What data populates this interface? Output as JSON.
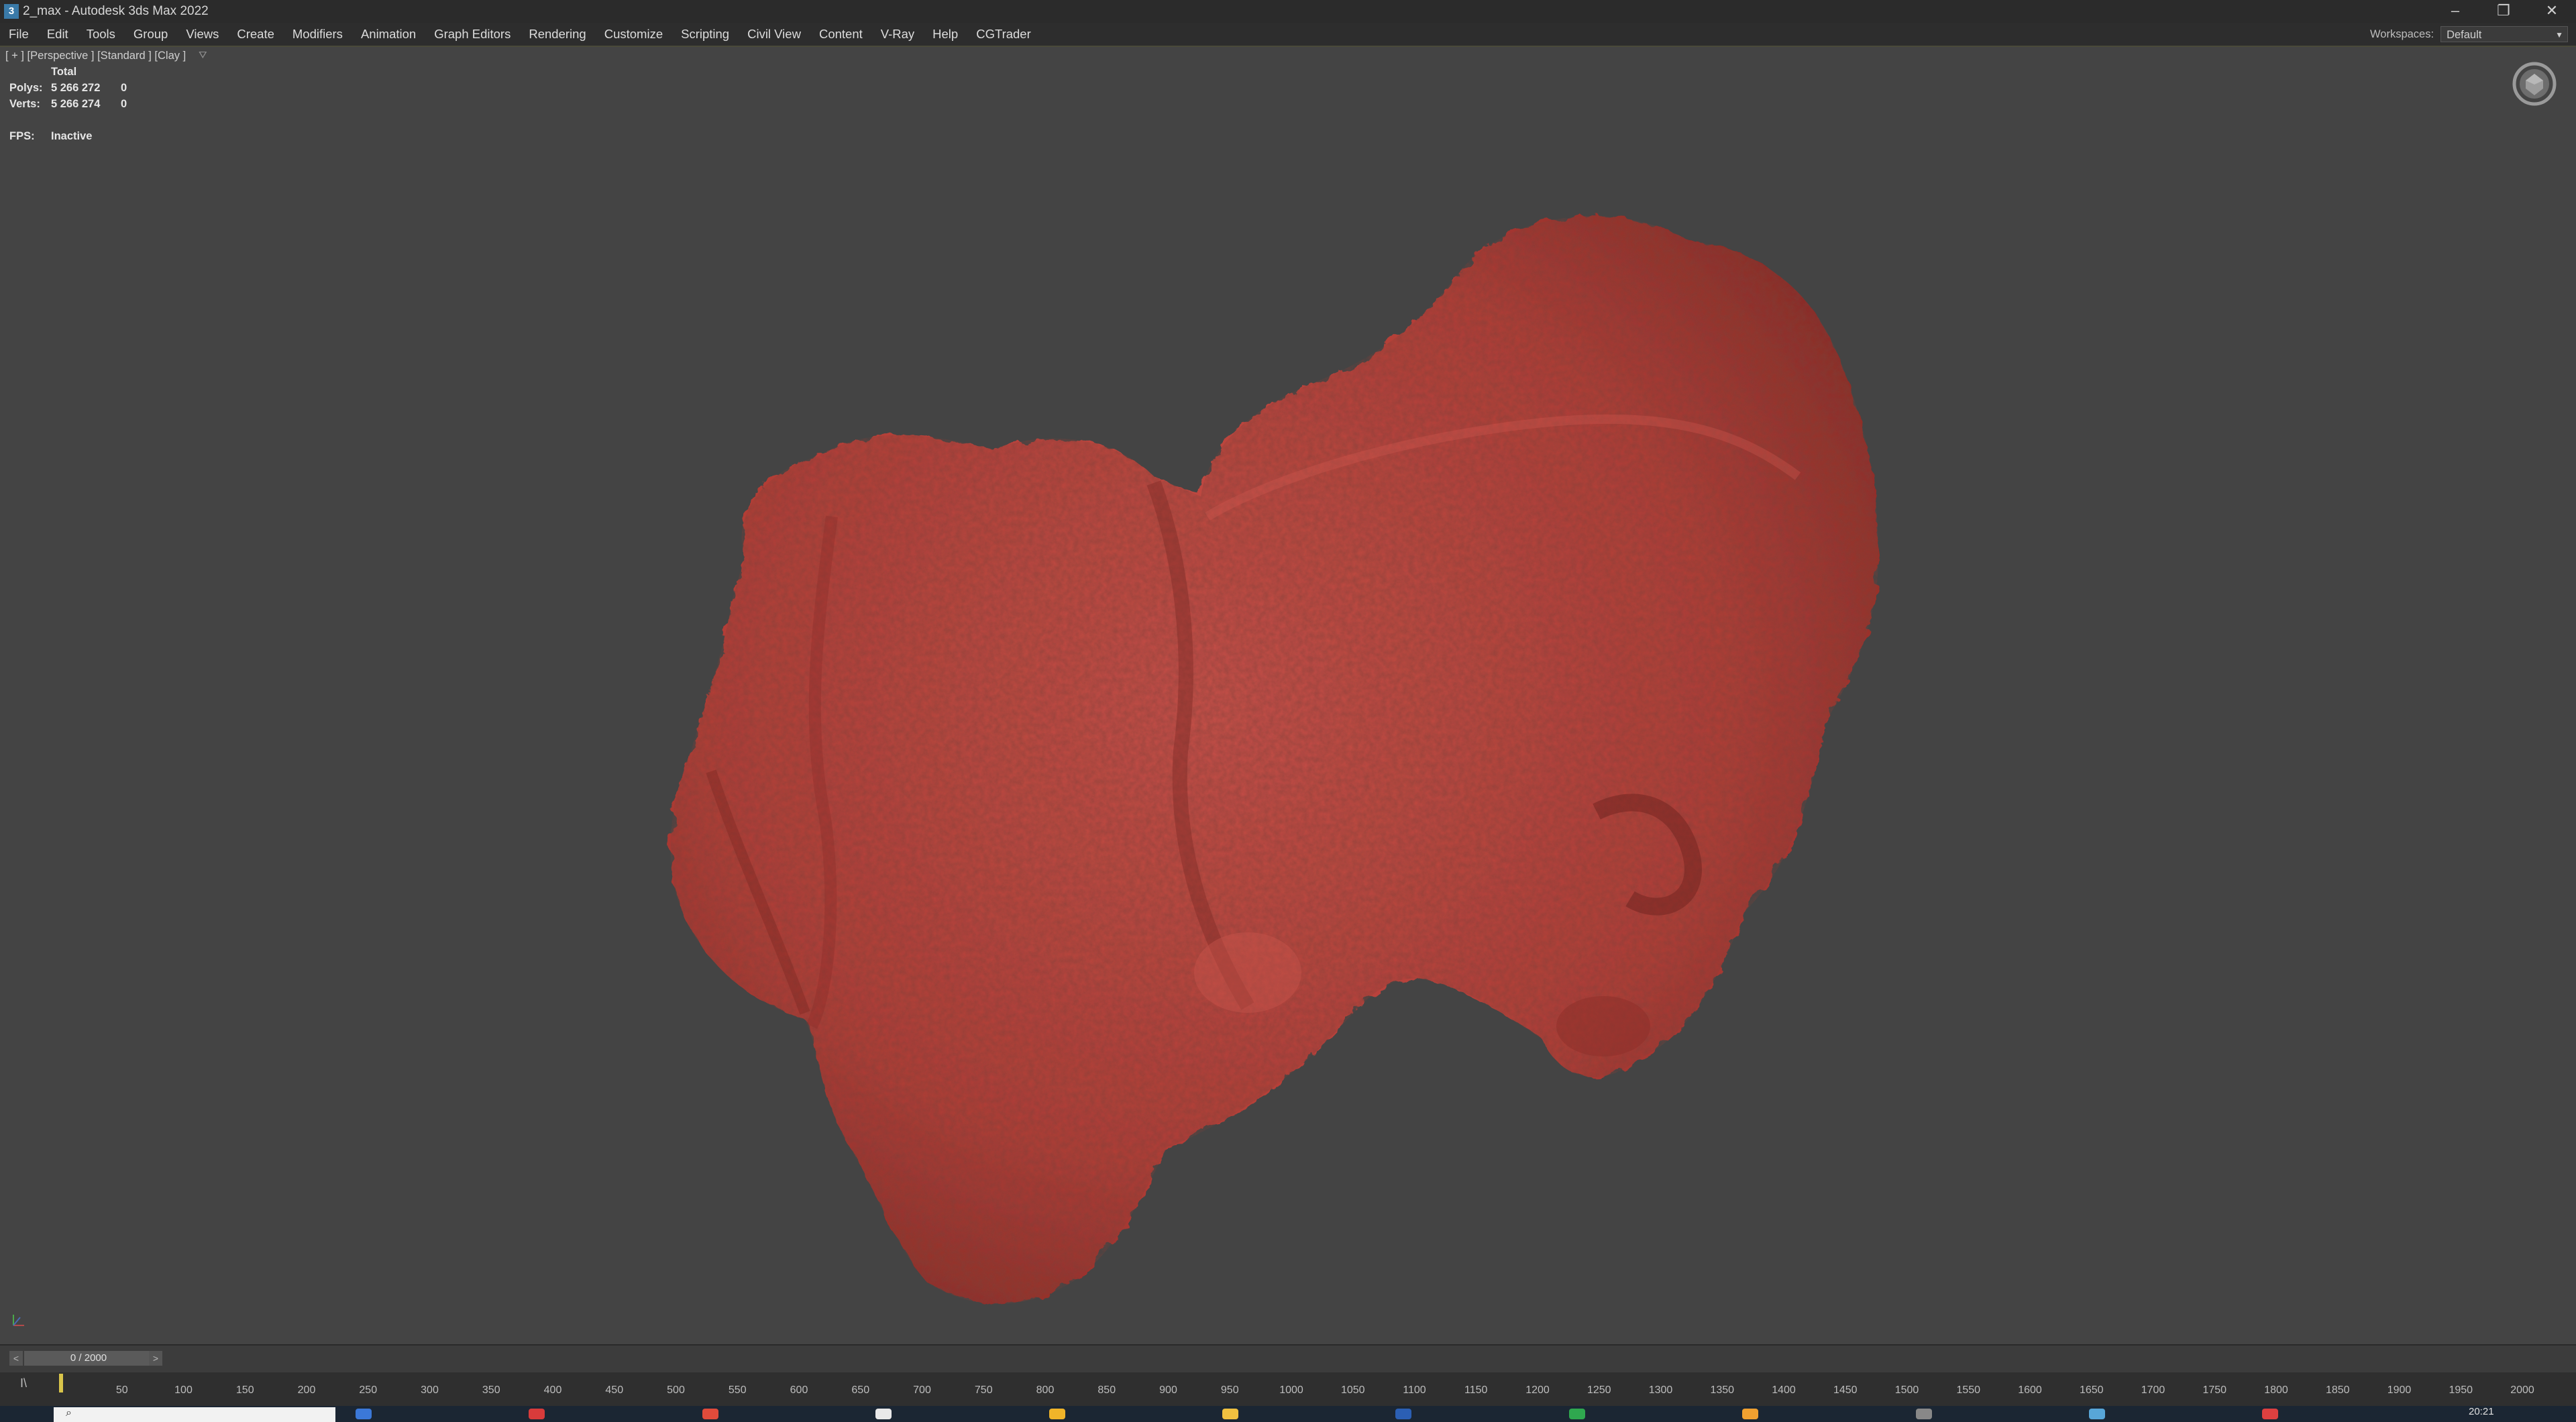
{
  "window": {
    "app_icon": "3",
    "title": "2_max - Autodesk 3ds Max 2022",
    "controls": {
      "minimize": "–",
      "restore": "❐",
      "close": "✕"
    }
  },
  "menu": {
    "items": [
      "File",
      "Edit",
      "Tools",
      "Group",
      "Views",
      "Create",
      "Modifiers",
      "Animation",
      "Graph Editors",
      "Rendering",
      "Customize",
      "Scripting",
      "Civil View",
      "Content",
      "V-Ray",
      "Help",
      "CGTrader"
    ],
    "workspaces_label": "Workspaces:",
    "workspaces_value": "Default"
  },
  "viewport": {
    "label": "[ + ] [Perspective ] [Standard ] [Clay ]",
    "filter_icon": "funnel-icon",
    "stats": {
      "total_label": "Total",
      "polys_label": "Polys:",
      "polys_value": "5 266 272",
      "polys_selected": "0",
      "verts_label": "Verts:",
      "verts_value": "5 266 274",
      "verts_selected": "0",
      "fps_label": "FPS:",
      "fps_value": "Inactive"
    },
    "model_color": "#c0473f",
    "background_color": "#444444"
  },
  "timeslider": {
    "prev": "<",
    "next": ">",
    "current": "0 / 2000"
  },
  "trackbar": {
    "key_icon": "I\\",
    "ticks": [
      "50",
      "100",
      "150",
      "200",
      "250",
      "300",
      "350",
      "400",
      "450",
      "500",
      "550",
      "600",
      "650",
      "700",
      "750",
      "800",
      "850",
      "900",
      "950",
      "1000",
      "1050",
      "1100",
      "1150",
      "1200",
      "1250",
      "1300",
      "1350",
      "1400",
      "1450",
      "1500",
      "1550",
      "1600",
      "1650",
      "1700",
      "1750",
      "1800",
      "1850",
      "1900",
      "1950",
      "2000"
    ]
  },
  "taskbar": {
    "time": "20:21",
    "accent_colors": [
      "#3b78d8",
      "#d83b3b",
      "#e04b3b",
      "#e9e9e9",
      "#f0b429",
      "#f0c040",
      "#2b5fb4",
      "#2fa84f",
      "#f0a030",
      "#888888",
      "#58a6d8",
      "#dd4040"
    ]
  }
}
